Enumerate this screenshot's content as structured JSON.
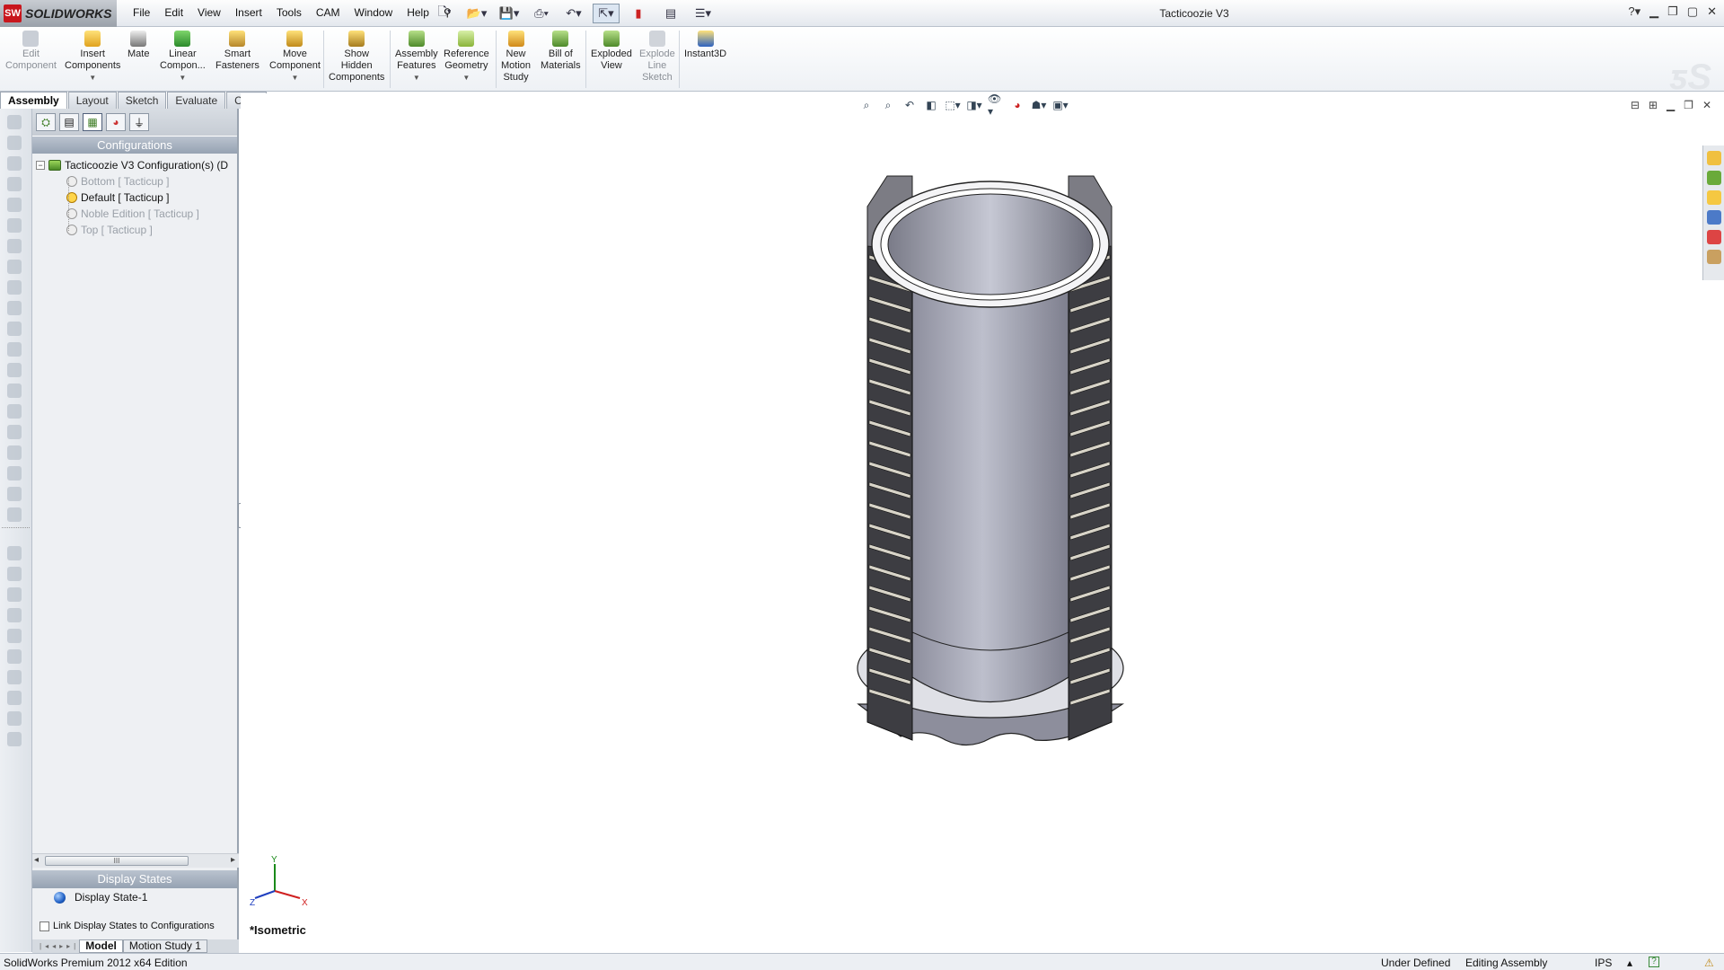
{
  "app": {
    "brand": "SOLIDWORKS",
    "window_title": "Tacticoozie V3"
  },
  "menu": [
    "File",
    "Edit",
    "View",
    "Insert",
    "Tools",
    "CAM",
    "Window",
    "Help"
  ],
  "ribbon": {
    "edit_component": "Edit\nComponent",
    "insert_components": "Insert\nComponents",
    "mate": "Mate",
    "linear_component": "Linear\nCompon...",
    "smart_fasteners": "Smart\nFasteners",
    "move_component": "Move\nComponent",
    "show_hidden": "Show\nHidden\nComponents",
    "assembly_features": "Assembly\nFeatures",
    "reference_geometry": "Reference\nGeometry",
    "new_motion_study": "New\nMotion\nStudy",
    "bill_of_materials": "Bill of\nMaterials",
    "exploded_view": "Exploded\nView",
    "explode_line_sketch": "Explode\nLine\nSketch",
    "instant3d": "Instant3D"
  },
  "command_tabs": [
    "Assembly",
    "Layout",
    "Sketch",
    "Evaluate",
    "CAM"
  ],
  "configuration_manager": {
    "header": "Configurations",
    "root": "Tacticoozie V3 Configuration(s)  (D",
    "items": [
      {
        "label": "Bottom [ Tacticup ]",
        "active": false
      },
      {
        "label": "Default [ Tacticup ]",
        "active": true
      },
      {
        "label": "Noble Edition [ Tacticup ]",
        "active": false
      },
      {
        "label": "Top [ Tacticup ]",
        "active": false
      }
    ]
  },
  "scroll_thumb": "III",
  "display_states": {
    "header": "Display States",
    "item": "Display State-1",
    "link_label": "Link Display States to Configurations"
  },
  "bottom_tabs": [
    "Model",
    "Motion Study 1"
  ],
  "viewport": {
    "view_label": "*Isometric",
    "axes": {
      "x": "X",
      "y": "Y",
      "z": "Z"
    }
  },
  "status": {
    "edition": "SolidWorks Premium 2012 x64 Edition",
    "state": "Under Defined",
    "mode": "Editing Assembly",
    "units": "IPS",
    "help": "?"
  },
  "colors": {
    "accent": "#96a2b2",
    "brand": "#c8161d",
    "part": "#a9abb8"
  }
}
